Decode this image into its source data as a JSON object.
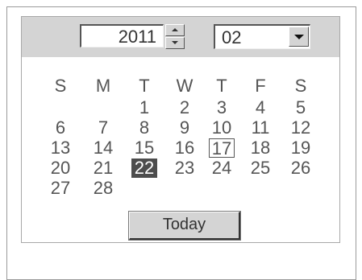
{
  "calendar": {
    "year": "2011",
    "month": "02",
    "weekdays": [
      "S",
      "M",
      "T",
      "W",
      "T",
      "F",
      "S"
    ],
    "weeks": [
      [
        "",
        "",
        "1",
        "2",
        "3",
        "4",
        "5"
      ],
      [
        "6",
        "7",
        "8",
        "9",
        "10",
        "11",
        "12"
      ],
      [
        "13",
        "14",
        "15",
        "16",
        "17",
        "18",
        "19"
      ],
      [
        "20",
        "21",
        "22",
        "23",
        "24",
        "25",
        "26"
      ],
      [
        "27",
        "28",
        "",
        "",
        "",
        "",
        ""
      ]
    ],
    "selected_day": "22",
    "today_day": "17",
    "today_button_label": "Today"
  }
}
